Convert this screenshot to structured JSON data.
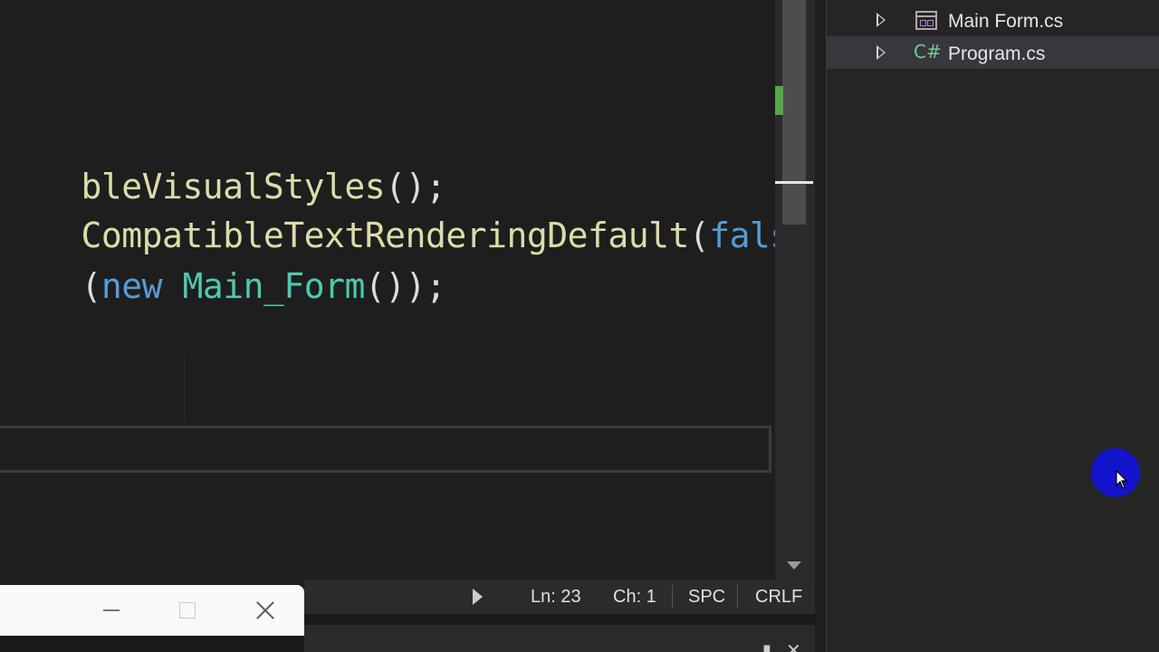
{
  "editor": {
    "lines": [
      [
        {
          "t": "bleVisualStyles",
          "c": "method"
        },
        {
          "t": "();",
          "c": "punct"
        }
      ],
      [
        {
          "t": "CompatibleTextRenderingDefault",
          "c": "method"
        },
        {
          "t": "(",
          "c": "punct"
        },
        {
          "t": "fals",
          "c": "kw"
        }
      ],
      [
        {
          "t": "(",
          "c": "punct"
        },
        {
          "t": "new",
          "c": "kw"
        },
        {
          "t": " ",
          "c": "punct"
        },
        {
          "t": "Main_Form",
          "c": "type"
        },
        {
          "t": "());",
          "c": "punct"
        }
      ]
    ]
  },
  "status_bar": {
    "line": "Ln: 23",
    "column": "Ch: 1",
    "indent": "SPC",
    "line_ending": "CRLF"
  },
  "explorer": {
    "items": [
      {
        "label": "Main Form.cs",
        "icon": "form-icon",
        "selected": false
      },
      {
        "label": "Program.cs",
        "icon": "csharp-file-icon",
        "selected": true
      }
    ]
  },
  "icons": {
    "csharp_glyph": "C#"
  },
  "colors": {
    "method": "#dcdcaa",
    "keyword": "#569cd6",
    "type": "#4ec9b0",
    "cursor_highlight": "#1414cc",
    "change_marker": "#57a64a"
  }
}
